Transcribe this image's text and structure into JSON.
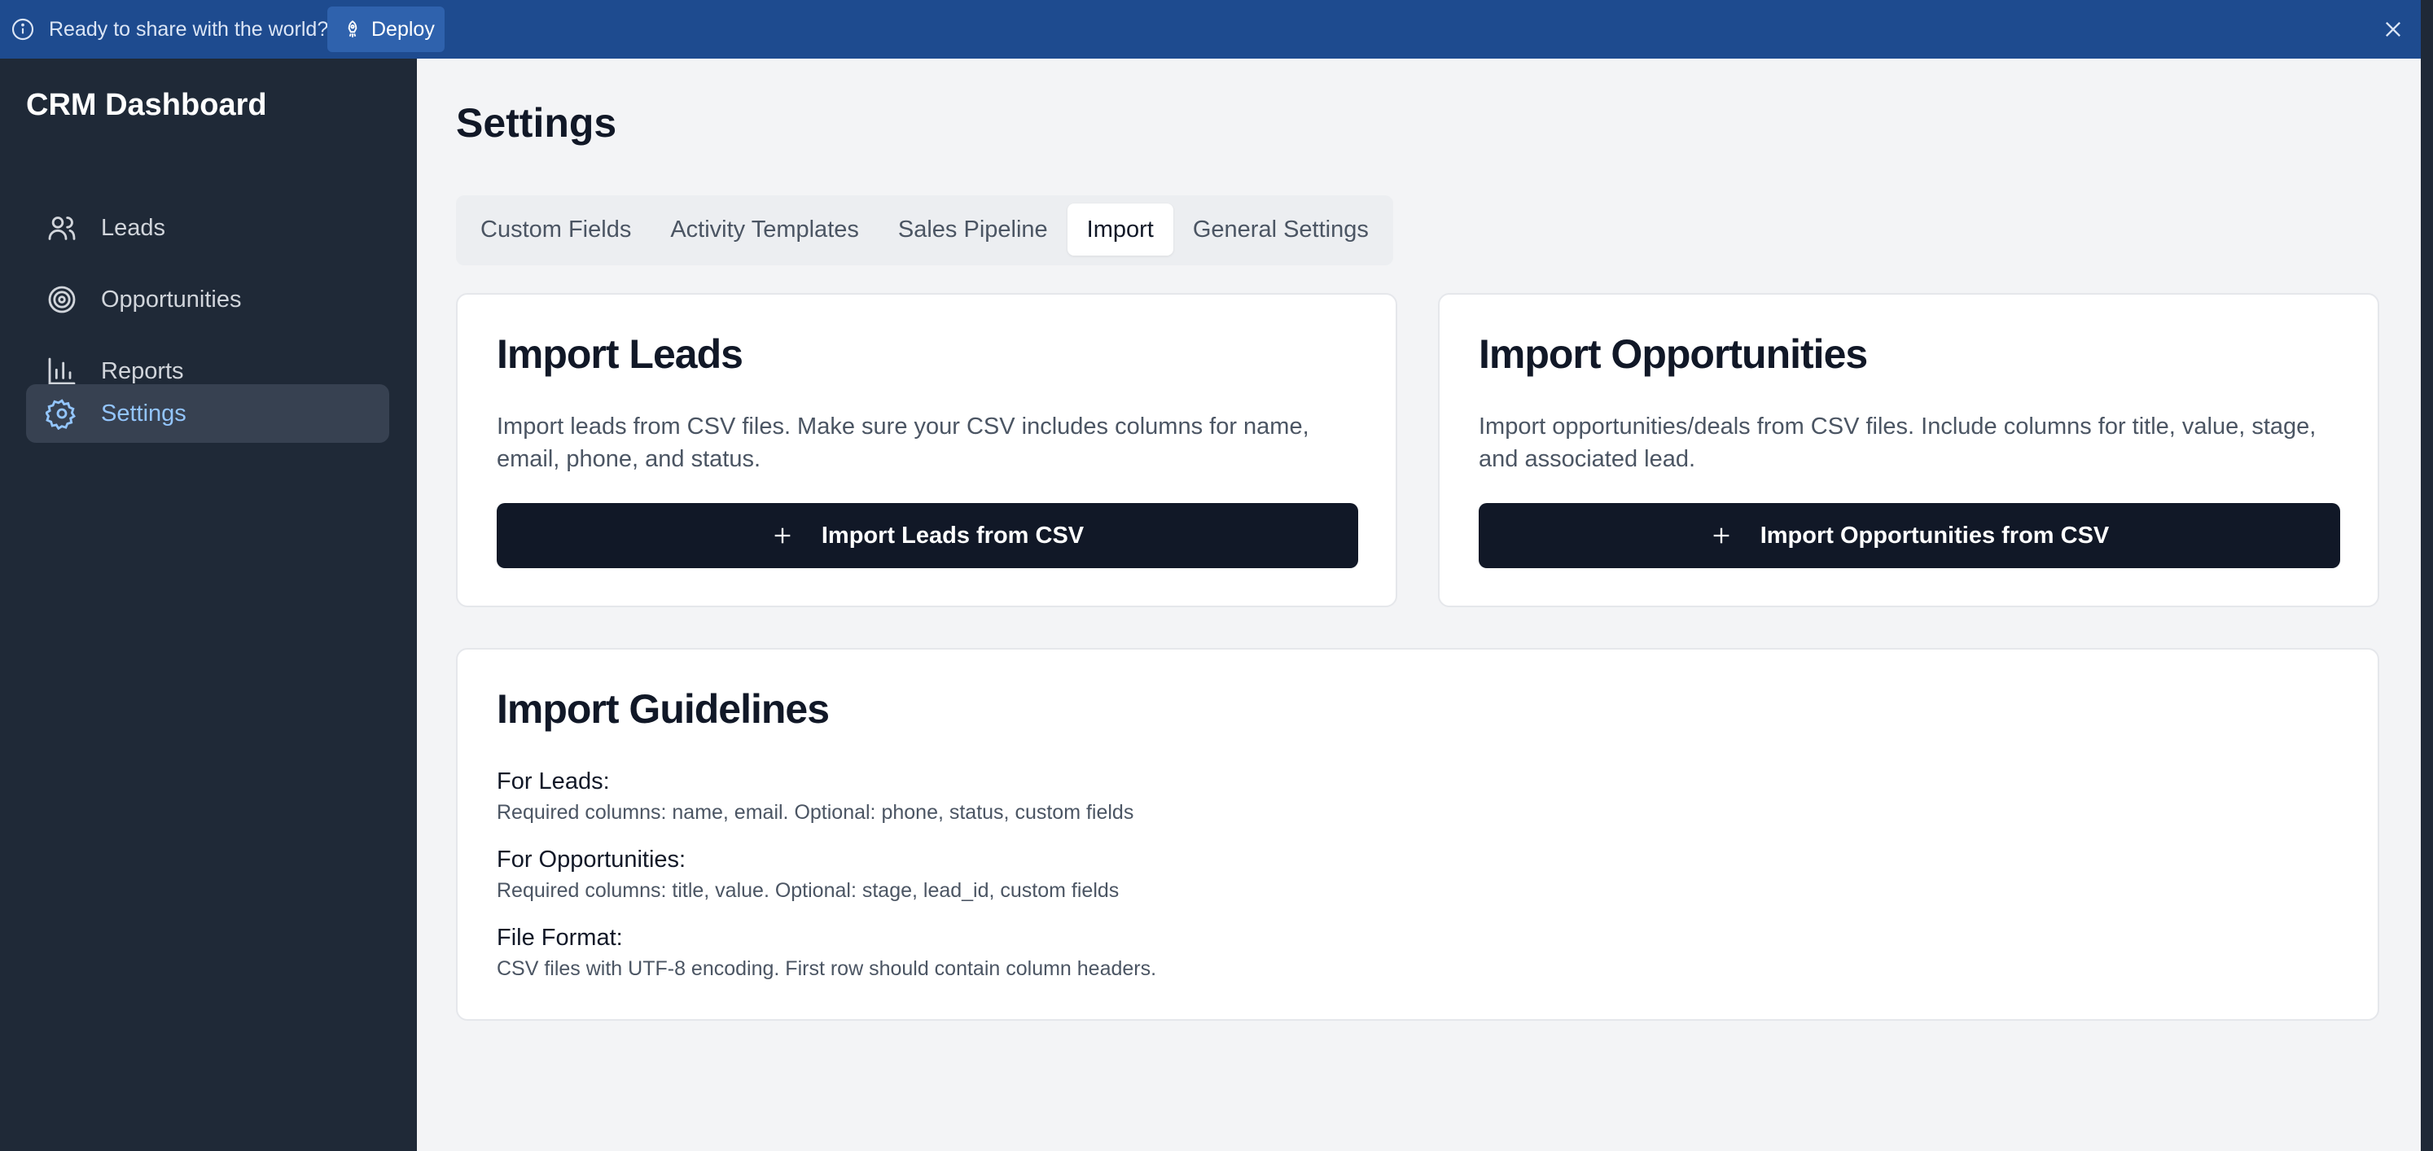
{
  "banner": {
    "message": "Ready to share with the world?",
    "deploy_label": "Deploy",
    "color": "#1e4b8f"
  },
  "sidebar": {
    "brand": "CRM Dashboard",
    "items": [
      {
        "label": "Leads",
        "icon": "users-icon"
      },
      {
        "label": "Opportunities",
        "icon": "target-icon"
      },
      {
        "label": "Reports",
        "icon": "bar-chart-icon"
      },
      {
        "label": "Settings",
        "icon": "gear-icon",
        "active": true
      }
    ]
  },
  "main": {
    "title": "Settings",
    "tabs": [
      {
        "label": "Custom Fields"
      },
      {
        "label": "Activity Templates"
      },
      {
        "label": "Sales Pipeline"
      },
      {
        "label": "Import",
        "active": true
      },
      {
        "label": "General Settings"
      }
    ],
    "import_leads": {
      "title": "Import Leads",
      "description": "Import leads from CSV files. Make sure your CSV includes columns for name, email, phone, and status.",
      "button": "Import Leads from CSV"
    },
    "import_opportunities": {
      "title": "Import Opportunities",
      "description": "Import opportunities/deals from CSV files. Include columns for title, value, stage, and associated lead.",
      "button": "Import Opportunities from CSV"
    },
    "guidelines": {
      "title": "Import Guidelines",
      "items": [
        {
          "heading": "For Leads:",
          "text": "Required columns: name, email. Optional: phone, status, custom fields"
        },
        {
          "heading": "For Opportunities:",
          "text": "Required columns: title, value. Optional: stage, lead_id, custom fields"
        },
        {
          "heading": "File Format:",
          "text": "CSV files with UTF-8 encoding. First row should contain column headers."
        }
      ]
    }
  },
  "colors": {
    "sidebar_bg": "#1f2937",
    "active_nav_text": "#93c5fd",
    "primary_button": "#111827"
  }
}
